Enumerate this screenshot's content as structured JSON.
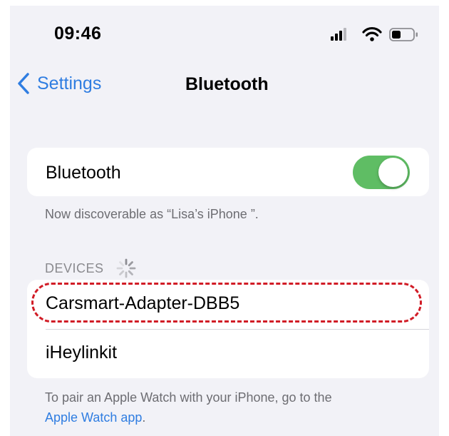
{
  "status_bar": {
    "time": "09:46",
    "icons": [
      "cellular-signal-icon",
      "wifi-icon",
      "battery-icon"
    ]
  },
  "nav": {
    "back_label": "Settings",
    "title": "Bluetooth"
  },
  "bluetooth": {
    "label": "Bluetooth",
    "enabled": true,
    "discoverable_text": "Now discoverable as “Lisa’s iPhone ”."
  },
  "devices": {
    "header": "DEVICES",
    "searching": true,
    "items": [
      {
        "name": "Carsmart-Adapter-DBB5",
        "highlighted": true
      },
      {
        "name": "iHeylinkit",
        "highlighted": false
      }
    ]
  },
  "apple_watch": {
    "text": "To pair an Apple Watch with your iPhone, go to the",
    "link": "Apple Watch app",
    "suffix": "."
  },
  "colors": {
    "accent_blue": "#2f7de1",
    "toggle_green": "#5fbd64",
    "highlight_red": "#d11c26",
    "background": "#f2f2f7"
  }
}
